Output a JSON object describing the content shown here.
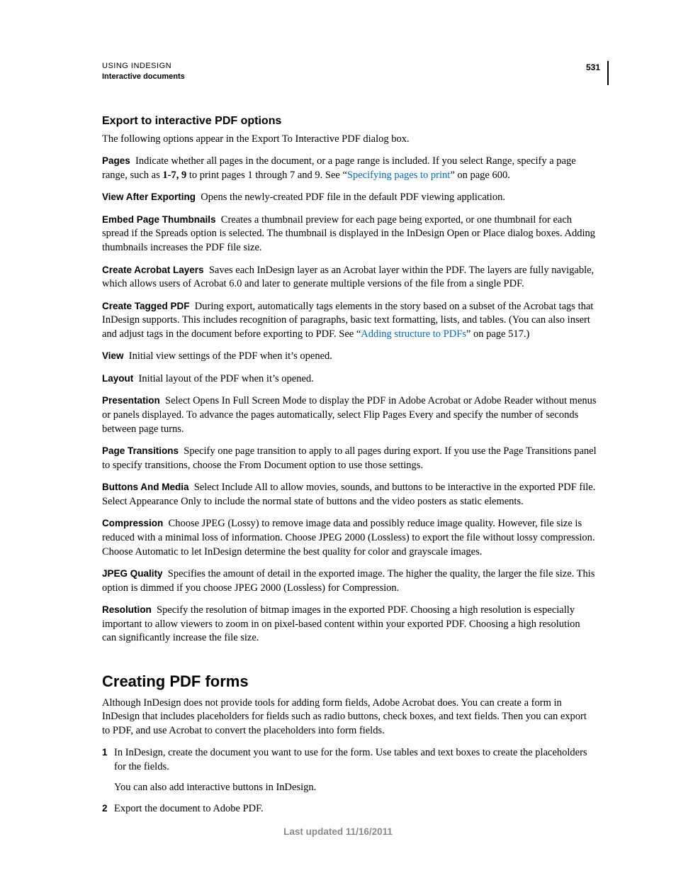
{
  "header": {
    "line1": "USING INDESIGN",
    "line2": "Interactive documents",
    "pageNumber": "531"
  },
  "section1": {
    "title": "Export to interactive PDF options",
    "intro": "The following options appear in the Export To Interactive PDF dialog box.",
    "options": {
      "pages": {
        "label": "Pages",
        "t1": "Indicate whether all pages in the document, or a page range is included. If you select Range, specify a page range, such as ",
        "bold": "1-7, 9",
        "t2": " to print pages 1 through 7 and 9. See “",
        "link": "Specifying pages to print",
        "t3": "” on page 600."
      },
      "viewAfter": {
        "label": "View After Exporting",
        "text": "Opens the newly-created PDF file in the default PDF viewing application."
      },
      "thumbnails": {
        "label": "Embed Page Thumbnails",
        "text": "Creates a thumbnail preview for each page being exported, or one thumbnail for each spread if the Spreads option is selected. The thumbnail is displayed in the InDesign Open or Place dialog boxes. Adding thumbnails increases the PDF file size."
      },
      "layers": {
        "label": "Create Acrobat Layers",
        "text": "Saves each InDesign layer as an Acrobat layer within the PDF. The layers are fully navigable, which allows users of Acrobat 6.0 and later to generate multiple versions of the file from a single PDF."
      },
      "tagged": {
        "label": "Create Tagged PDF",
        "t1": "During export, automatically tags elements in the story based on a subset of the Acrobat tags that InDesign supports. This includes recognition of paragraphs, basic text formatting, lists, and tables. (You can also insert and adjust tags in the document before exporting to PDF. See “",
        "link": "Adding structure to PDFs",
        "t2": "” on page 517.)"
      },
      "view": {
        "label": "View",
        "text": "Initial view settings of the PDF when it’s opened."
      },
      "layout": {
        "label": "Layout",
        "text": "Initial layout of the PDF when it’s opened."
      },
      "presentation": {
        "label": "Presentation",
        "text": "Select Opens In Full Screen Mode to display the PDF in Adobe Acrobat or Adobe Reader without menus or panels displayed. To advance the pages automatically, select Flip Pages Every and specify the number of seconds between page turns."
      },
      "transitions": {
        "label": "Page Transitions",
        "text": "Specify one page transition to apply to all pages during export. If you use the Page Transitions panel to specify transitions, choose the From Document option to use those settings."
      },
      "buttons": {
        "label": "Buttons And Media",
        "text": "Select Include All to allow movies, sounds, and buttons to be interactive in the exported PDF file. Select Appearance Only to include the normal state of buttons and the video posters as static elements."
      },
      "compression": {
        "label": "Compression",
        "text": "Choose JPEG (Lossy) to remove image data and possibly reduce image quality. However, file size is reduced with a minimal loss of information. Choose JPEG 2000 (Lossless) to export the file without lossy compression. Choose Automatic to let InDesign determine the best quality for color and grayscale images."
      },
      "jpeg": {
        "label": "JPEG Quality",
        "text": "Specifies the amount of detail in the exported image. The higher the quality, the larger the file size. This option is dimmed if you choose JPEG 2000 (Lossless) for Compression."
      },
      "resolution": {
        "label": "Resolution",
        "text": "Specify the resolution of bitmap images in the exported PDF. Choosing a high resolution is especially important to allow viewers to zoom in on pixel-based content within your exported PDF. Choosing a high resolution can significantly increase the file size."
      }
    }
  },
  "section2": {
    "title": "Creating PDF forms",
    "intro": "Although InDesign does not provide tools for adding form fields, Adobe Acrobat does. You can create a form in InDesign that includes placeholders for fields such as radio buttons, check boxes, and text fields. Then you can export to PDF, and use Acrobat to convert the placeholders into form fields.",
    "steps": [
      {
        "num": "1",
        "text": "In InDesign, create the document you want to use for the form. Use tables and text boxes to create the placeholders for the fields.",
        "sub": "You can also add interactive buttons in InDesign."
      },
      {
        "num": "2",
        "text": "Export the document to Adobe PDF."
      }
    ]
  },
  "footer": "Last updated 11/16/2011"
}
